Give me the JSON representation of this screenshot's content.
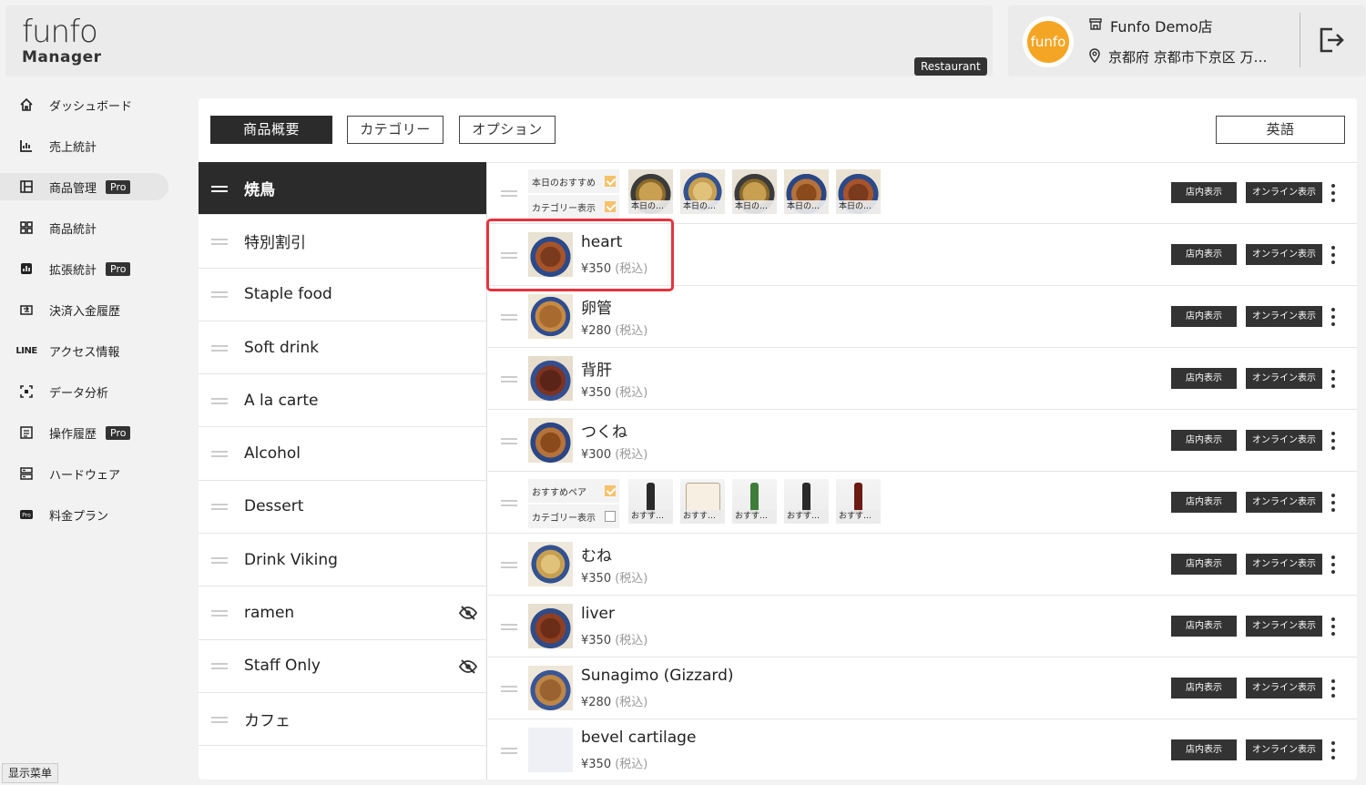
{
  "header": {
    "logo_top": "funfo",
    "logo_bottom": "Manager",
    "badge": "Restaurant",
    "avatar_text": "funfo",
    "store_name": "Funfo Demo店",
    "store_address": "京都府 京都市下京区 万…"
  },
  "sidebar": {
    "items": [
      {
        "label": "ダッシュボード",
        "icon": "home-icon",
        "pro": false
      },
      {
        "label": "売上統計",
        "icon": "bar-chart-icon",
        "pro": false
      },
      {
        "label": "商品管理",
        "icon": "layout-icon",
        "pro": true
      },
      {
        "label": "商品統計",
        "icon": "grid-icon",
        "pro": false
      },
      {
        "label": "拡張統計",
        "icon": "chart-box-icon",
        "pro": true
      },
      {
        "label": "決済入金履歴",
        "icon": "transfer-icon",
        "pro": false
      },
      {
        "label": "アクセス情報",
        "icon": "line-icon",
        "pro": false
      },
      {
        "label": "データ分析",
        "icon": "scan-icon",
        "pro": false
      },
      {
        "label": "操作履歴",
        "icon": "list-icon",
        "pro": true
      },
      {
        "label": "ハードウェア",
        "icon": "server-icon",
        "pro": false
      },
      {
        "label": "料金プラン",
        "icon": "pro-icon",
        "pro": false
      }
    ],
    "pro_label": "Pro",
    "line_text": "LINE"
  },
  "status_text": "显示菜单",
  "tabs": {
    "overview": "商品概要",
    "category": "カテゴリー",
    "options": "オプション",
    "language": "英語"
  },
  "categories": [
    {
      "label": "焼鳥",
      "hidden": false
    },
    {
      "label": "特別割引",
      "hidden": false
    },
    {
      "label": "Staple food",
      "hidden": false
    },
    {
      "label": "Soft drink",
      "hidden": false
    },
    {
      "label": "A la carte",
      "hidden": false
    },
    {
      "label": "Alcohol",
      "hidden": false
    },
    {
      "label": "Dessert",
      "hidden": false
    },
    {
      "label": "Drink Viking",
      "hidden": false
    },
    {
      "label": "ramen",
      "hidden": true
    },
    {
      "label": "Staff Only",
      "hidden": true
    },
    {
      "label": "カフェ",
      "hidden": false
    }
  ],
  "buttons": {
    "store_display": "店内表示",
    "online_display": "オンライン表示"
  },
  "groups": {
    "g1": {
      "flag1": "本日のおすすめ",
      "flag1_checked": true,
      "flag2": "カテゴリー表示",
      "flag2_checked": true,
      "captions": [
        "本日の…",
        "本日の…",
        "本日の…",
        "本日の…",
        "本日の…"
      ]
    },
    "g2": {
      "flag1": "おすすめペア",
      "flag1_checked": true,
      "flag2": "カテゴリー表示",
      "flag2_checked": false,
      "captions": [
        "おすす…",
        "おすす…",
        "おすす…",
        "おすす…",
        "おすす…"
      ]
    }
  },
  "products": [
    {
      "name": "heart",
      "price": "¥350",
      "tax": "(税込)"
    },
    {
      "name": "卵管",
      "price": "¥280",
      "tax": "(税込)"
    },
    {
      "name": "背肝",
      "price": "¥350",
      "tax": "(税込)"
    },
    {
      "name": "つくね",
      "price": "¥300",
      "tax": "(税込)"
    },
    {
      "name": "むね",
      "price": "¥350",
      "tax": "(税込)"
    },
    {
      "name": "liver",
      "price": "¥350",
      "tax": "(税込)"
    },
    {
      "name": "Sunagimo (Gizzard)",
      "price": "¥280",
      "tax": "(税込)"
    },
    {
      "name": "bevel cartilage",
      "price": "¥350",
      "tax": "(税込)"
    }
  ],
  "colors": {
    "accent": "#f5a524",
    "highlight": "#e8323c",
    "dark": "#2b2b2b"
  }
}
